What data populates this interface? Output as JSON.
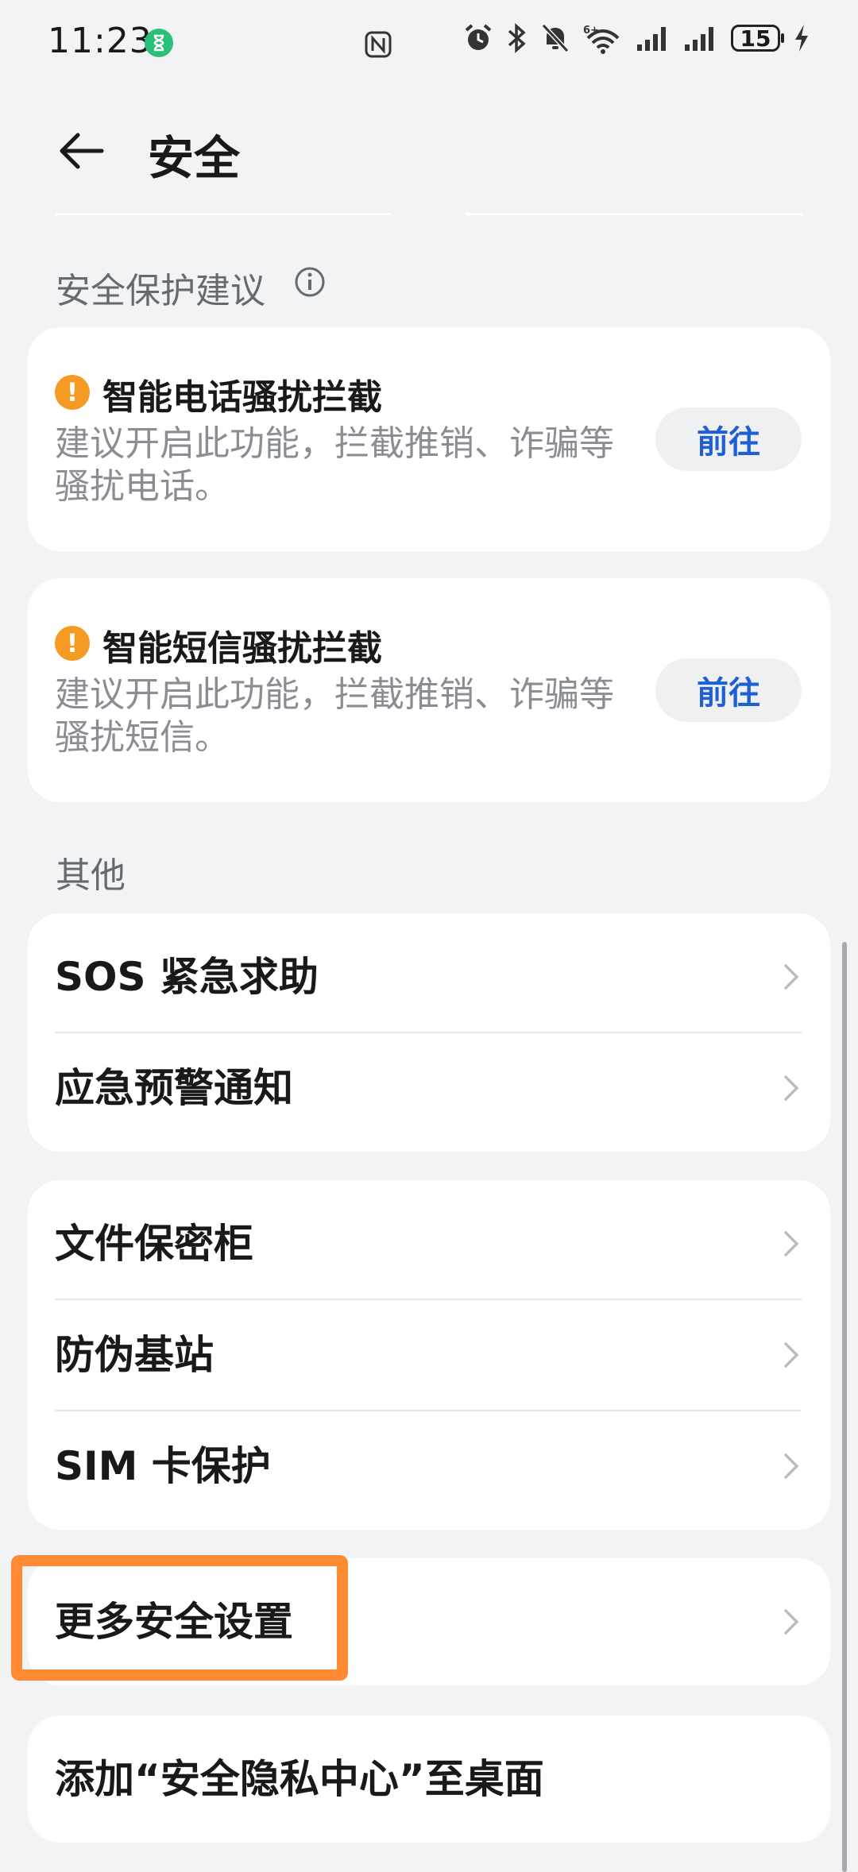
{
  "status_bar": {
    "time": "11:23",
    "battery": "15",
    "icons": [
      "hourglass-icon",
      "nfc-icon",
      "alarm-icon",
      "bluetooth-icon",
      "mute-icon",
      "wifi-icon",
      "signal-icon",
      "signal-icon",
      "battery-icon",
      "charging-icon"
    ]
  },
  "header": {
    "title": "安全",
    "back_icon": "arrow-left-icon"
  },
  "suggestions": {
    "section_label": "安全保护建议",
    "info_icon": "info-icon",
    "cards": [
      {
        "title": "智能电话骚扰拦截",
        "desc": "建议开启此功能，拦截推销、诈骗等骚扰电话。",
        "button": "前往"
      },
      {
        "title": "智能短信骚扰拦截",
        "desc": "建议开启此功能，拦截推销、诈骗等骚扰短信。",
        "button": "前往"
      }
    ]
  },
  "others": {
    "section_label": "其他",
    "group1": [
      {
        "label": "SOS 紧急求助"
      },
      {
        "label": "应急预警通知"
      }
    ],
    "group2": [
      {
        "label": "文件保密柜"
      },
      {
        "label": "防伪基站"
      },
      {
        "label": "SIM 卡保护"
      }
    ],
    "more_settings": "更多安全设置",
    "add_to_desktop": "添加“安全隐私中心”至桌面"
  },
  "colors": {
    "background": "#f1f3f5",
    "accent_blue": "#1f5fd6",
    "warning_orange": "#f59a23",
    "highlight_orange": "#ff8a33"
  }
}
